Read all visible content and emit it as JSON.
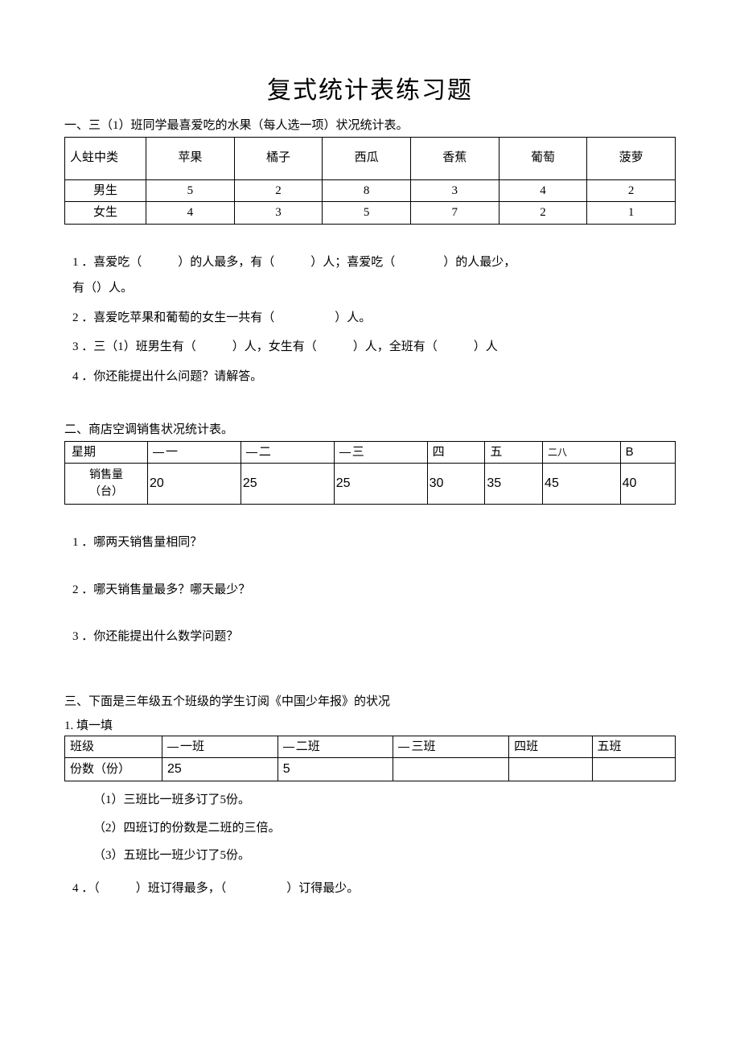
{
  "title": "复式统计表练习题",
  "section1": {
    "heading": "一、三（1）班同学最喜爱吃的水果（每人选一项）状况统计表。",
    "corner": "人蛀中类",
    "headers": [
      "苹果",
      "橘子",
      "西瓜",
      "香蕉",
      "葡萄",
      "菠萝"
    ],
    "rows": [
      {
        "label": "男生",
        "vals": [
          "5",
          "2",
          "8",
          "3",
          "4",
          "2"
        ]
      },
      {
        "label": "女生",
        "vals": [
          "4",
          "3",
          "5",
          "7",
          "2",
          "1"
        ]
      }
    ],
    "q1a": "1 ．喜爱吃（　　　）的人最多，有（　　　）人；喜爱吃（　　　　）的人最少，",
    "q1b": "有（）人。",
    "q2": "2 ．喜爱吃苹果和葡萄的女生一共有（　　　　　）人。",
    "q3": "3 ．三（1）班男生有（　　　）人，女生有（　　　）人，全班有（　　　）人",
    "q4": "4 ．你还能提出什么问题？请解答。"
  },
  "section2": {
    "heading": "二、商店空调销售状况统计表。",
    "row1_label": "星期",
    "days": [
      "一",
      "二",
      "三",
      "四",
      "五",
      "二八",
      "B"
    ],
    "row2_label1": "销售量",
    "row2_label2": "（台）",
    "vals": [
      "20",
      "25",
      "25",
      "30",
      "35",
      "45",
      "40"
    ],
    "q1": "1 ．哪两天销售量相同？",
    "q2": "2 ．哪天销售量最多？哪天最少？",
    "q3": "3 ．你还能提出什么数学问题？"
  },
  "section3": {
    "heading": "三、下面是三年级五个班级的学生订阅《中国少年报》的状况",
    "sub": "1. 填一填",
    "row1_label": "班级",
    "classes": [
      "一班",
      "二班",
      "三班",
      "四班",
      "五班"
    ],
    "row2_label": "份数（份）",
    "vals": [
      "25",
      "5",
      "",
      "",
      ""
    ],
    "c1": "（1）三班比一班多订了5份。",
    "c2": "（2）四班订的份数是二班的三倍。",
    "c3": "（3）五班比一班少订了5份。",
    "q4": "4 ．（　　　）班订得最多，（　　　　　）订得最少。"
  }
}
